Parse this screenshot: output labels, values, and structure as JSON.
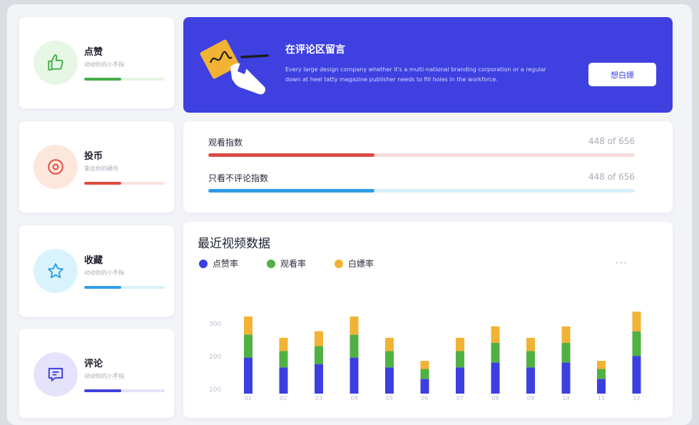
{
  "stats": [
    {
      "title": "点赞",
      "subtitle": "动动你的小手指",
      "icon": "thumbs-up-icon",
      "color": "#45ad4b",
      "bg": "#e7f7e5",
      "track": "#e3f5e0",
      "level": 0.46
    },
    {
      "title": "投币",
      "subtitle": "拿出你的硬币",
      "icon": "target-coin-icon",
      "color": "#e04b3f",
      "bg": "#fde6dc",
      "track": "#fbe2dd",
      "level": 0.46
    },
    {
      "title": "收藏",
      "subtitle": "动动你的小手指",
      "icon": "star-icon",
      "color": "#2f9fe6",
      "bg": "#d9f3fd",
      "track": "#d8f1fb",
      "level": 0.46
    },
    {
      "title": "评论",
      "subtitle": "动动你的小手指",
      "icon": "message-icon",
      "color": "#3f3fd9",
      "bg": "#e5e3fb",
      "track": "#e3e2fa",
      "level": 0.46
    }
  ],
  "banner": {
    "title": "在评论区留言",
    "description": "Every large design company whether it's a multi-national branding corporation or a regular down at heel tatty magazine publisher needs to fill holes in the workforce.",
    "button_label": "想白嫖",
    "bg_color": "#3e41e0"
  },
  "progress": [
    {
      "label": "观看指数",
      "count": "448 of 656",
      "value": 448,
      "max": 656,
      "color": "#d94a45",
      "track": "#f5dcdb"
    },
    {
      "label": "只看不评论指数",
      "count": "448 of 656",
      "value": 448,
      "max": 656,
      "color": "#2f9be5",
      "track": "#d6f0fb"
    }
  ],
  "chart_section": {
    "more_label": "···"
  },
  "chart_data": {
    "type": "bar",
    "title": "最近视频数据",
    "categories": [
      "01",
      "02",
      "03",
      "04",
      "05",
      "06",
      "07",
      "08",
      "09",
      "10",
      "11",
      "12"
    ],
    "series": [
      {
        "name": "点赞率",
        "color": "#3c3fe0",
        "values": [
          110,
          80,
          90,
          110,
          80,
          45,
          80,
          95,
          80,
          95,
          45,
          115
        ]
      },
      {
        "name": "观看率",
        "color": "#4fb142",
        "values": [
          70,
          50,
          55,
          70,
          50,
          30,
          50,
          60,
          50,
          60,
          30,
          75
        ]
      },
      {
        "name": "白嫖率",
        "color": "#f2b234",
        "values": [
          55,
          40,
          45,
          55,
          40,
          25,
          40,
          50,
          40,
          50,
          25,
          60
        ]
      }
    ],
    "ylim": [
      100,
      320
    ],
    "yticks": [
      100,
      200,
      300
    ],
    "legend": "top-left",
    "grid": false
  }
}
